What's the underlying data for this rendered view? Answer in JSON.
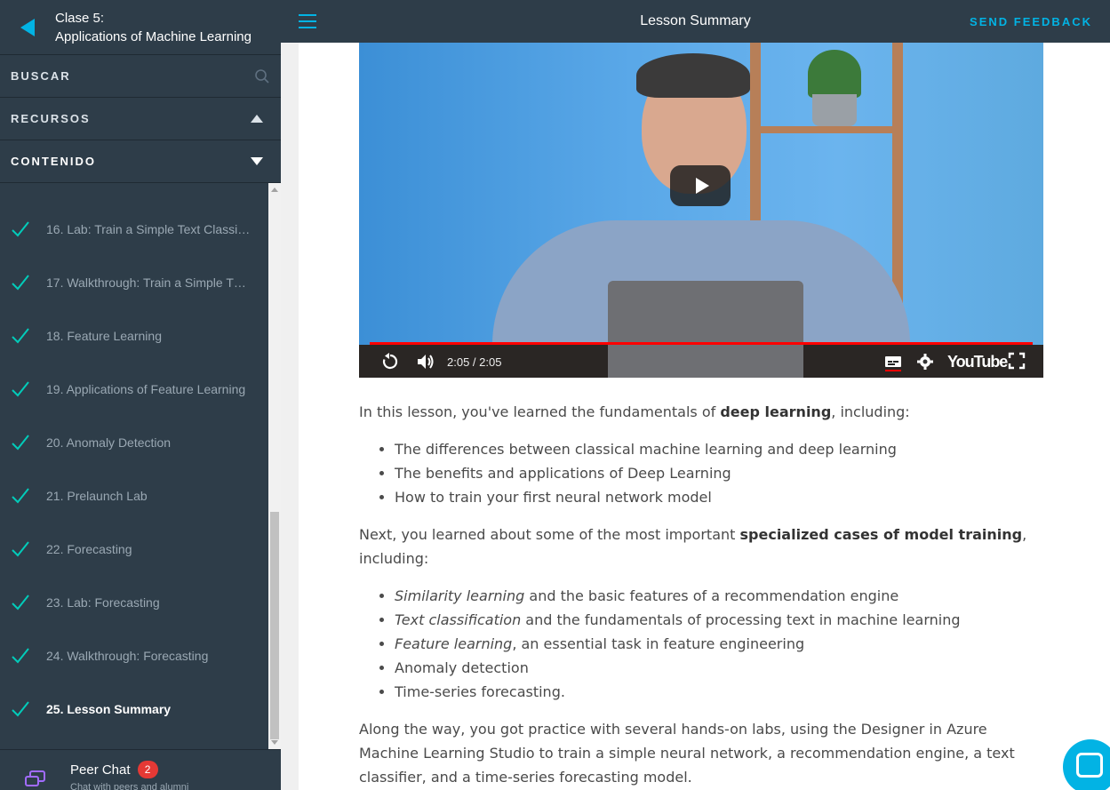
{
  "sidebar": {
    "lesson_number": "Clase 5:",
    "lesson_title": "Applications of Machine Learning",
    "search_label": "BUSCAR",
    "resources_label": "RECURSOS",
    "contents_label": "CONTENIDO",
    "concepts": [
      {
        "label": "16. Lab: Train a Simple Text Classi…",
        "done": true
      },
      {
        "label": "17. Walkthrough: Train a Simple T…",
        "done": true
      },
      {
        "label": "18. Feature Learning",
        "done": true
      },
      {
        "label": "19. Applications of Feature Learning",
        "done": true
      },
      {
        "label": "20. Anomaly Detection",
        "done": true
      },
      {
        "label": "21. Prelaunch Lab",
        "done": true
      },
      {
        "label": "22. Forecasting",
        "done": true
      },
      {
        "label": "23. Lab: Forecasting",
        "done": true
      },
      {
        "label": "24. Walkthrough: Forecasting",
        "done": true
      },
      {
        "label": "25. Lesson Summary",
        "done": true
      }
    ],
    "peer_chat": {
      "title": "Peer Chat",
      "badge": "2",
      "subtitle": "Chat with peers and alumni"
    }
  },
  "topbar": {
    "title": "Lesson Summary",
    "feedback": "SEND FEEDBACK"
  },
  "video": {
    "time": "2:05 / 2:05",
    "progress": 1.0,
    "brand": "YouTube"
  },
  "content": {
    "p1_pre": "In this lesson, you've learned the fundamentals of ",
    "p1_bold": "deep learning",
    "p1_post": ", including:",
    "list1": [
      "The differences between classical machine learning and deep learning",
      "The benefits and applications of Deep Learning",
      "How to train your first neural network model"
    ],
    "p2_pre": "Next, you learned about some of the most important ",
    "p2_bold": "specialized cases of model training",
    "p2_post": ", including:",
    "list2": [
      {
        "em": "Similarity learning",
        "rest": " and the basic features of a recommendation engine"
      },
      {
        "em": "Text classification",
        "rest": " and the fundamentals of processing text in machine learning"
      },
      {
        "em": "Feature learning",
        "rest": ", an essential task in feature engineering"
      },
      {
        "em": "",
        "rest": "Anomaly detection"
      },
      {
        "em": "",
        "rest": "Time-series forecasting."
      }
    ],
    "p3": "Along the way, you got practice with several hands-on labs, using the Designer in Azure Machine Learning Studio to train a simple neural network, a recommendation engine, a text classifier, and a time-series forecasting model."
  },
  "colors": {
    "accent": "#02b3e4",
    "sidebar_bg": "#2e3d49",
    "check": "#02ccba"
  }
}
